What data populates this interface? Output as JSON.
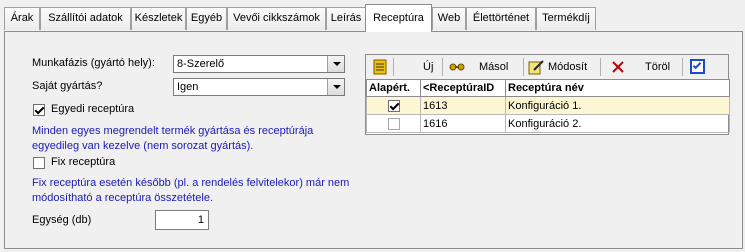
{
  "tabs": [
    "Árak",
    "Szállítói adatok",
    "Készletek",
    "Egyéb",
    "Vevői cikkszámok",
    "Leírás",
    "Receptúra",
    "Web",
    "Élettörténet",
    "Termékdíj"
  ],
  "form": {
    "munkafazis_label": "Munkafázis (gyártó hely):",
    "munkafazis_value": "8-Szerelő",
    "sajat_label": "Saját gyártás?",
    "sajat_value": "Igen",
    "egyedi_label": "Egyedi receptúra",
    "egyedi_checked": true,
    "egyedi_info_1": "Minden egyes megrendelt termék gyártása és receptúrája",
    "egyedi_info_2": "egyedileg van kezelve (nem sorozat gyártás).",
    "fix_label": "Fix receptúra",
    "fix_checked": false,
    "fix_info_1": "Fix receptúra esetén később (pl. a rendelés felvitelekor) már nem",
    "fix_info_2": "módosítható a receptúra összetétele.",
    "egyseg_label": "Egység (db)",
    "egyseg_value": "1"
  },
  "toolbar": {
    "new_label": "Új",
    "copy_label": "Másol",
    "edit_label": "Módosít",
    "delete_label": "Töröl"
  },
  "grid": {
    "columns": [
      "Alapért.",
      "<ReceptúraID",
      "Receptúra név"
    ],
    "rows": [
      {
        "default": true,
        "id": "1613",
        "name": "Konfiguráció 1."
      },
      {
        "default": false,
        "id": "1616",
        "name": "Konfiguráció 2."
      }
    ]
  }
}
